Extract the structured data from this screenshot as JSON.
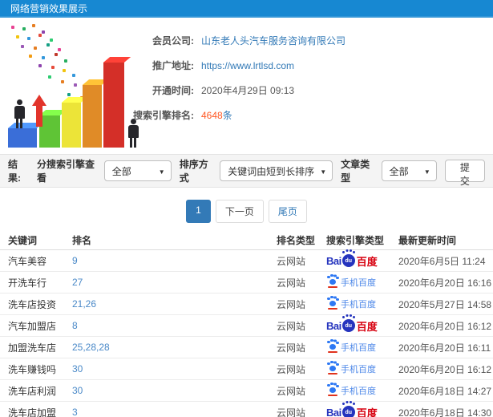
{
  "colors": {
    "header-blue": "#1788d2",
    "link-blue": "#337ab7",
    "rank-blue": "#4a89c8",
    "highlight-orange": "#ff5722",
    "baidu-blue": "#2534be",
    "baidu-red": "#d7000f",
    "paw-blue": "#2d78f4",
    "mobile-blue": "#4a86e8"
  },
  "header": {
    "title": "网络营销效果展示"
  },
  "info": {
    "company_label": "会员公司:",
    "company_value": "山东老人头汽车服务咨询有限公司",
    "url_label": "推广地址:",
    "url_value": "https://www.lrtlsd.com",
    "opened_label": "开通时间:",
    "opened_value": "2020年4月29日 09:13",
    "ranking_label": "搜索引擎排名:",
    "ranking_value": "4648",
    "ranking_suffix": "条"
  },
  "filters": {
    "result_label": "结果:",
    "engine_label": "分搜索引擎查看",
    "engine_value": "全部",
    "sort_label": "排序方式",
    "sort_value": "关键词由短到长排序",
    "article_label": "文章类型",
    "article_value": "全部",
    "caret": "▼",
    "submit_label": "提交"
  },
  "pagination": {
    "current": "1",
    "next": "下一页",
    "last": "尾页"
  },
  "logos": {
    "baidu": {
      "bai": "Bai",
      "du": "du",
      "name": "百度"
    },
    "mobile_baidu": {
      "label": "手机百度"
    }
  },
  "table": {
    "headers": [
      "关键词",
      "排名",
      "排名类型",
      "搜索引擎类型",
      "最新更新时间"
    ],
    "rows": [
      {
        "keyword": "汽车美容",
        "rank": "9",
        "rank_type": "云网站",
        "engine": "baidu",
        "updated": "2020年6月5日 11:24"
      },
      {
        "keyword": "开洗车行",
        "rank": "27",
        "rank_type": "云网站",
        "engine": "mobile_baidu",
        "updated": "2020年6月20日 16:16"
      },
      {
        "keyword": "洗车店投资",
        "rank": "21,26",
        "rank_type": "云网站",
        "engine": "mobile_baidu",
        "updated": "2020年5月27日 14:58"
      },
      {
        "keyword": "汽车加盟店",
        "rank": "8",
        "rank_type": "云网站",
        "engine": "baidu",
        "updated": "2020年6月20日 16:12"
      },
      {
        "keyword": "加盟洗车店",
        "rank": "25,28,28",
        "rank_type": "云网站",
        "engine": "mobile_baidu",
        "updated": "2020年6月20日 16:11"
      },
      {
        "keyword": "洗车赚钱吗",
        "rank": "30",
        "rank_type": "云网站",
        "engine": "mobile_baidu",
        "updated": "2020年6月20日 16:12"
      },
      {
        "keyword": "洗车店利润",
        "rank": "30",
        "rank_type": "云网站",
        "engine": "mobile_baidu",
        "updated": "2020年6月18日 14:27"
      },
      {
        "keyword": "洗车店加盟",
        "rank": "3",
        "rank_type": "云网站",
        "engine": "baidu",
        "updated": "2020年6月18日 14:30"
      }
    ]
  }
}
